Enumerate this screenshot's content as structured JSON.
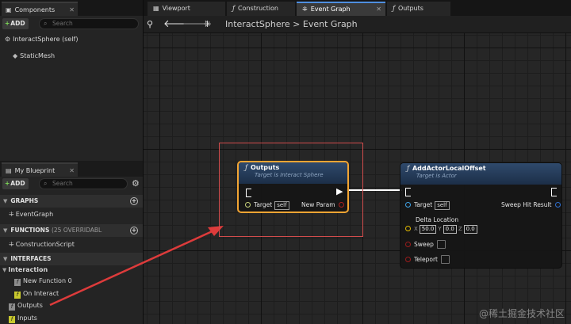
{
  "components_panel": {
    "tab_label": "Components",
    "add_label": "ADD",
    "search_placeholder": "Search",
    "items": [
      "InteractSphere (self)",
      "StaticMesh"
    ]
  },
  "my_blueprint_panel": {
    "tab_label": "My Blueprint",
    "add_label": "ADD",
    "search_placeholder": "Search",
    "graphs_header": "GRAPHS",
    "graphs_items": [
      "EventGraph"
    ],
    "functions_header": "FUNCTIONS",
    "functions_sub": "(25 OVERRIDABL",
    "functions_items": [
      "ConstructionScript"
    ],
    "interfaces_header": "INTERFACES",
    "interaction_label": "Interaction",
    "interaction_items": [
      "New Function 0",
      "On Interact"
    ],
    "extra_items": [
      "Outputs",
      "Inputs"
    ]
  },
  "editor_tabs": [
    "Viewport",
    "Construction Scrip",
    "Event Graph",
    "Outputs"
  ],
  "active_tab": "Event Graph",
  "breadcrumb": "InteractSphere > Event Graph",
  "nodes": {
    "outputs": {
      "title": "Outputs",
      "subtitle": "Target is Interact Sphere",
      "target_label": "Target",
      "target_value": "self",
      "param_label": "New Param"
    },
    "add_offset": {
      "title": "AddActorLocalOffset",
      "subtitle": "Target is Actor",
      "target_label": "Target",
      "target_value": "self",
      "sweep_hit_label": "Sweep Hit Result",
      "delta_label": "Delta Location",
      "x_label": "X",
      "x_value": "50.0",
      "y_label": "Y",
      "y_value": "0.0",
      "z_label": "Z",
      "z_value": "0.0",
      "sweep_label": "Sweep",
      "teleport_label": "Teleport"
    }
  },
  "watermark": "@稀土掘金技术社区",
  "colors": {
    "selection_outline": "#f3a533",
    "annotation_red": "#d24c4c",
    "active_tab_accent": "#4f8fe0",
    "node_header": "#2f4a6c"
  }
}
